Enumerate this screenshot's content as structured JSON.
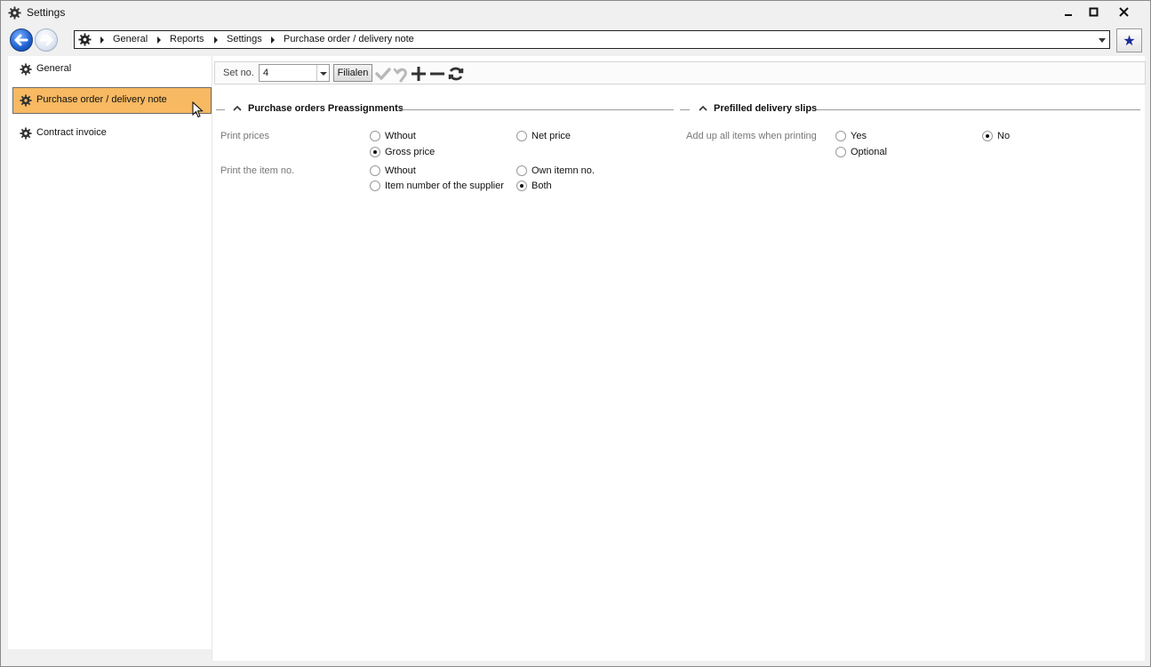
{
  "window": {
    "title": "Settings"
  },
  "breadcrumb": [
    "General",
    "Reports",
    "Settings",
    "Purchase order / delivery note"
  ],
  "sidebar": {
    "items": [
      {
        "label": "General",
        "active": false
      },
      {
        "label": "Purchase order / delivery note",
        "active": true
      },
      {
        "label": "Contract invoice",
        "active": false
      }
    ]
  },
  "toolbar": {
    "set_no_label": "Set no.",
    "set_no_value": "4",
    "filialen_label": "Filialen"
  },
  "sections": {
    "purchase": {
      "title": "Purchase orders Preassignments",
      "print_prices": {
        "label": "Print prices",
        "options": [
          "Wthout",
          "Net price",
          "Gross price"
        ],
        "selected": "Gross price"
      },
      "print_item_no": {
        "label": "Print the item no.",
        "options": [
          "Wthout",
          "Own itemn no.",
          "Item number of the supplier",
          "Both"
        ],
        "selected": "Both"
      }
    },
    "delivery": {
      "title": "Prefilled delivery slips",
      "add_up": {
        "label": "Add up all items when printing",
        "options": [
          "Yes",
          "No",
          "Optional"
        ],
        "selected": "No"
      }
    }
  },
  "colors": {
    "active_item": "#f7b962",
    "favorite_star": "#1a2a9a",
    "back_button": "#1d5fcf"
  }
}
